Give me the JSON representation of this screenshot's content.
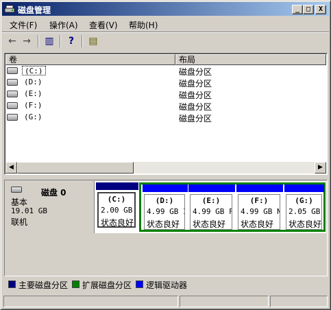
{
  "window": {
    "title": "磁盘管理"
  },
  "titlebar_buttons": {
    "minimize": "_",
    "maximize": "□",
    "close": "X"
  },
  "menu": [
    {
      "label": "文件(F)"
    },
    {
      "label": "操作(A)"
    },
    {
      "label": "查看(V)"
    },
    {
      "label": "帮助(H)"
    }
  ],
  "toolbar": {
    "back_icon": "←",
    "forward_icon": "→",
    "console_icon": "▥",
    "help_icon": "?",
    "properties_icon": "▤"
  },
  "volume_list": {
    "columns": [
      "卷",
      "布局"
    ],
    "rows": [
      {
        "name": "(C:)",
        "layout": "磁盘分区"
      },
      {
        "name": "(D:)",
        "layout": "磁盘分区"
      },
      {
        "name": "(E:)",
        "layout": "磁盘分区"
      },
      {
        "name": "(F:)",
        "layout": "磁盘分区"
      },
      {
        "name": "(G:)",
        "layout": "磁盘分区"
      }
    ],
    "scroll_left": "◀",
    "scroll_right": "▶"
  },
  "disk": {
    "name": "磁盘 0",
    "type": "基本",
    "size": "19.01 GB",
    "status": "联机",
    "partitions": [
      {
        "name": "(C:)",
        "size": "2.00 GB",
        "status": "状态良好"
      },
      {
        "name": "(D:)",
        "size": "4.99 GB I",
        "status": "状态良好"
      },
      {
        "name": "(E:)",
        "size": "4.99 GB F",
        "status": "状态良好"
      },
      {
        "name": "(F:)",
        "size": "4.99 GB N",
        "status": "状态良好"
      },
      {
        "name": "(G:)",
        "size": "2.05 GB",
        "status": "状态良好"
      }
    ]
  },
  "legend": [
    {
      "label": "主要磁盘分区",
      "color": "#000080"
    },
    {
      "label": "扩展磁盘分区",
      "color": "#008000"
    },
    {
      "label": "逻辑驱动器",
      "color": "#0000ff"
    }
  ]
}
